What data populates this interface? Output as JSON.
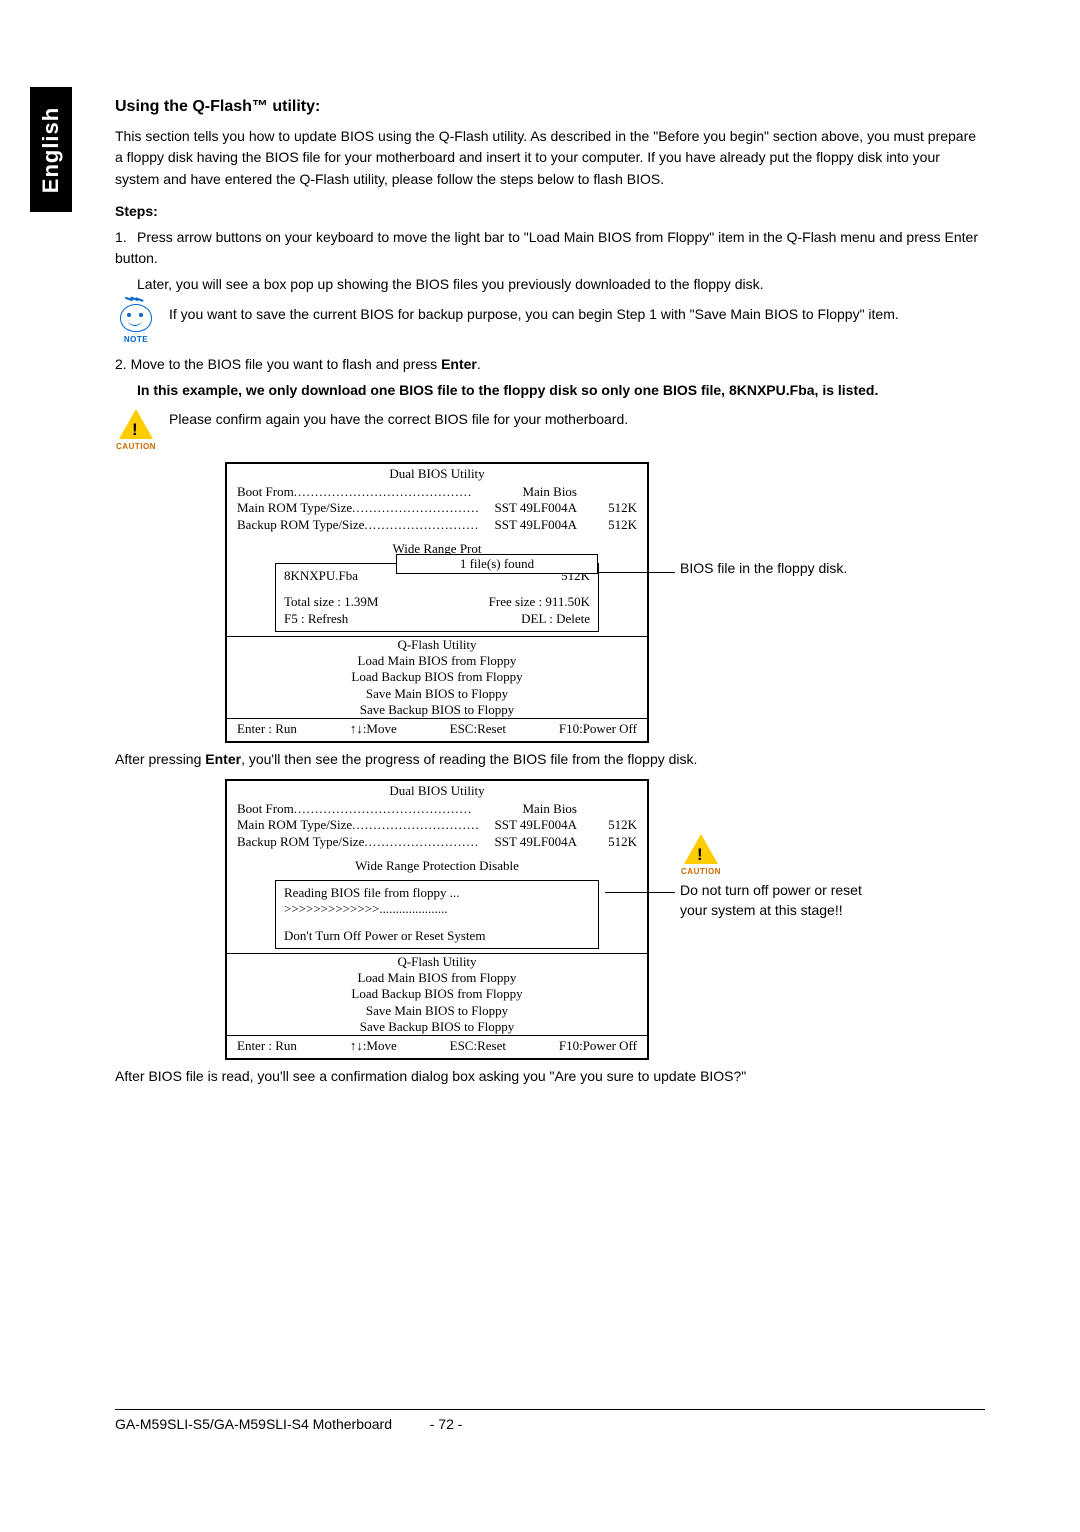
{
  "sidebar": {
    "language": "English"
  },
  "headings": {
    "main": "Using the Q-Flash™ utility:",
    "steps": "Steps:"
  },
  "intro": "This section tells you how to update BIOS using the Q-Flash utility. As described in the \"Before you begin\" section above, you must prepare a floppy disk having the BIOS file for your motherboard and insert it to your computer. If you have already put the floppy disk into your system and have entered the Q-Flash utility, please follow the steps below to flash BIOS.",
  "step1": {
    "num": "1.",
    "text": "Press arrow buttons on your keyboard to move the light bar to \"Load Main BIOS from Floppy\" item in the Q-Flash menu and press Enter button.",
    "later": "Later, you will see a box pop up showing the BIOS files you previously downloaded to the floppy disk."
  },
  "note": {
    "label": "NOTE",
    "text": "If you want to save the current BIOS for backup purpose, you can begin Step 1 with \"Save Main BIOS to Floppy\" item."
  },
  "step2": {
    "line": "2. Move to the BIOS file you want to flash and press ",
    "enter": "Enter",
    "period": ".",
    "bold": "In this example, we only download one BIOS file to the floppy disk so only one BIOS file, 8KNXPU.Fba, is listed."
  },
  "caution1": {
    "label": "CAUTION",
    "text": "Please confirm again you have the correct BIOS file for your motherboard."
  },
  "bios_common": {
    "title": "Dual BIOS Utility",
    "boot_label": "Boot From",
    "boot_val": "Main Bios",
    "main_rom_label": "Main ROM Type/Size",
    "main_rom_val": "SST 49LF004A",
    "main_rom_size": "512K",
    "backup_rom_label": "Backup ROM Type/Size",
    "backup_rom_val": "SST 49LF004A",
    "backup_rom_size": "512K",
    "wide_range": "Wide Range Protection    Disable",
    "qflash": "Q-Flash Utility",
    "menu": [
      "Load Main BIOS from Floppy",
      "Load Backup BIOS from Floppy",
      "Save Main BIOS to Floppy",
      "Save Backup BIOS to Floppy"
    ],
    "foot": {
      "enter": "Enter : Run",
      "move": "↑↓:Move",
      "esc": "ESC:Reset",
      "f10": "F10:Power Off"
    }
  },
  "box1": {
    "files_found": "1 file(s) found",
    "file_name": "8KNXPU.Fba",
    "file_size": "512K",
    "total": "Total size : 1.39M",
    "free": "Free size : 911.50K",
    "f5": "F5 : Refresh",
    "del": "DEL : Delete",
    "annotation": "BIOS file in the floppy disk."
  },
  "between": {
    "pre": "After pressing ",
    "enter": "Enter",
    "post": ", you'll then see the progress of reading the BIOS file from the floppy disk."
  },
  "box2": {
    "reading": "Reading BIOS file from floppy ...",
    "progress": ">>>>>>>>>>>>>",
    "progress_dots": ".....................",
    "warn": "Don't Turn Off Power or Reset System",
    "annotation": "Do not turn off power or reset your system at this stage!!",
    "label": "CAUTION"
  },
  "after_read": "After BIOS file is read, you'll see a confirmation dialog box asking you \"Are you sure to update BIOS?\"",
  "footer": {
    "model": "GA-M59SLI-S5/GA-M59SLI-S4 Motherboard",
    "page": "- 72 -"
  }
}
